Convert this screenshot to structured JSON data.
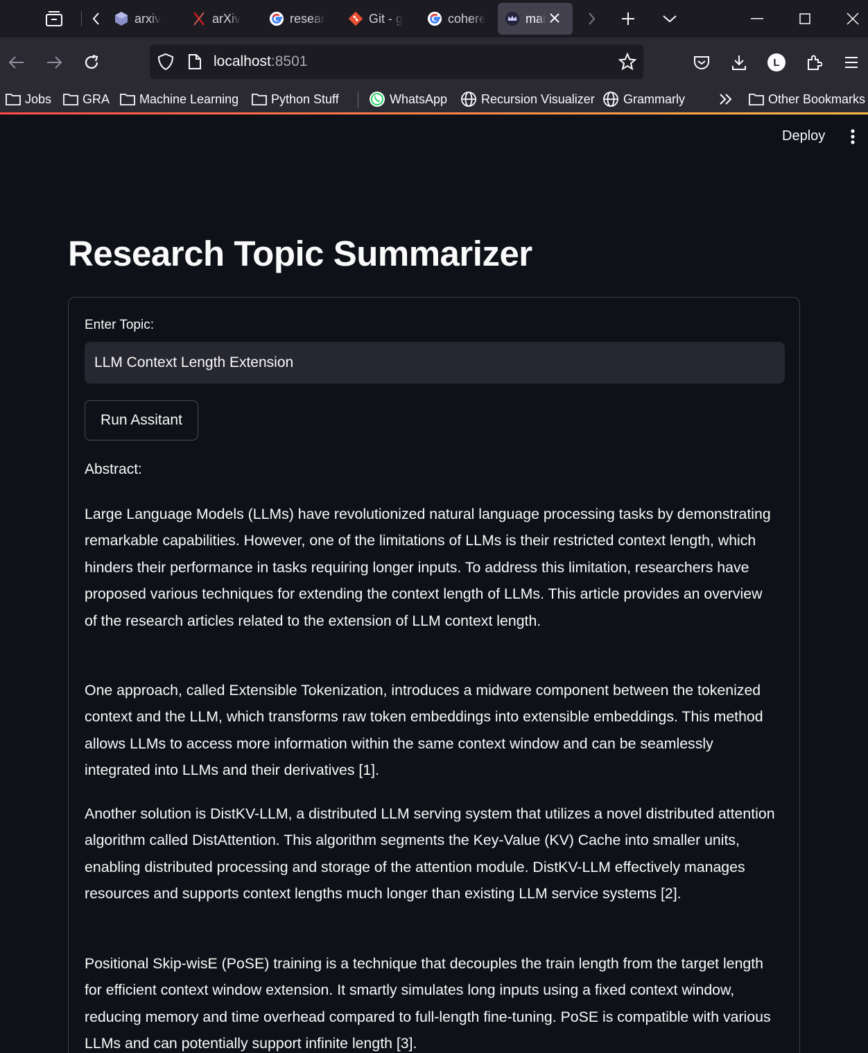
{
  "browser": {
    "tabs": [
      {
        "label": "arxiv",
        "icon": "cube-icon"
      },
      {
        "label": "arXiv",
        "icon": "arxiv-x-icon"
      },
      {
        "label": "resear",
        "icon": "google-g-icon"
      },
      {
        "label": "Git - g",
        "icon": "git-icon"
      },
      {
        "label": "cohere",
        "icon": "google-g-icon"
      },
      {
        "label": "mai",
        "icon": "crown-icon",
        "active": true
      }
    ],
    "url": {
      "host": "localhost",
      "port": ":8501"
    },
    "bookmarks": [
      {
        "label": "Jobs",
        "icon": "folder-icon"
      },
      {
        "label": "GRA",
        "icon": "folder-icon"
      },
      {
        "label": "Machine Learning",
        "icon": "folder-icon"
      },
      {
        "label": "Python Stuff",
        "icon": "folder-icon"
      },
      {
        "label": "WhatsApp",
        "icon": "whatsapp-icon"
      },
      {
        "label": "Recursion Visualizer",
        "icon": "globe-icon"
      },
      {
        "label": "Grammarly",
        "icon": "globe-icon"
      }
    ],
    "other_bookmarks": "Other Bookmarks",
    "profile_initial": "L"
  },
  "app": {
    "deploy_label": "Deploy",
    "title": "Research Topic Summarizer",
    "form": {
      "topic_label": "Enter Topic:",
      "topic_value": "LLM Context Length Extension",
      "run_button": "Run Assitant",
      "abstract_label": "Abstract:",
      "paragraphs": [
        "Large Language Models (LLMs) have revolutionized natural language processing tasks by demonstrating remarkable capabilities. However, one of the limitations of LLMs is their restricted context length, which hinders their performance in tasks requiring longer inputs. To address this limitation, researchers have proposed various techniques for extending the context length of LLMs. This article provides an overview of the research articles related to the extension of LLM context length.",
        "One approach, called Extensible Tokenization, introduces a midware component between the tokenized context and the LLM, which transforms raw token embeddings into extensible embeddings. This method allows LLMs to access more information within the same context window and can be seamlessly integrated into LLMs and their derivatives [1].",
        "Another solution is DistKV-LLM, a distributed LLM serving system that utilizes a novel distributed attention algorithm called DistAttention. This algorithm segments the Key-Value (KV) Cache into smaller units, enabling distributed processing and storage of the attention module. DistKV-LLM effectively manages resources and supports context lengths much longer than existing LLM service systems [2].",
        "Positional Skip-wisE (PoSE) training is a technique that decouples the train length from the target length for efficient context window extension. It smartly simulates long inputs using a fixed context window, reducing memory and time overhead compared to full-length fine-tuning. PoSE is compatible with various LLMs and can potentially support infinite length [3]."
      ]
    }
  },
  "colors": {
    "app_bg": "#0e1117",
    "input_bg": "#262730",
    "accent_gradient_start": "#ff4b4b",
    "accent_gradient_end": "#ffbd45",
    "chrome_tabbar": "#1c1b22",
    "chrome_toolbar": "#2b2a33"
  }
}
